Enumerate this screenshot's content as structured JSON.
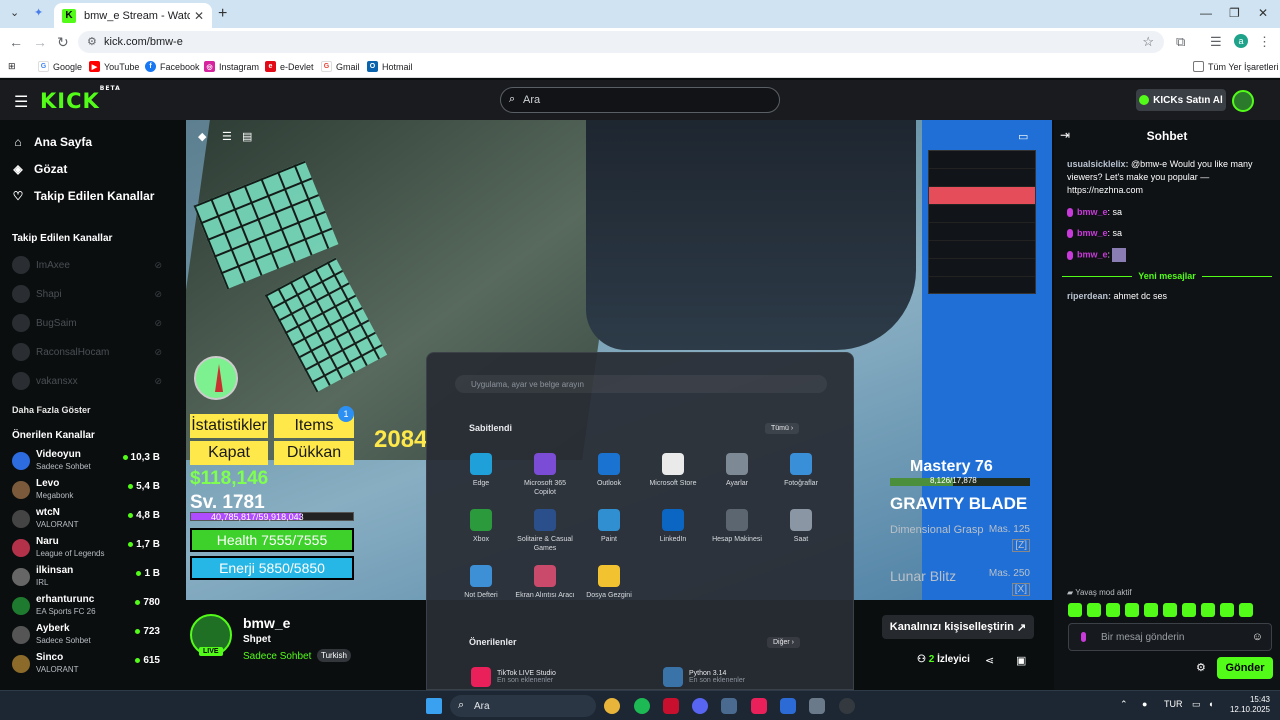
{
  "browser": {
    "tab_title": "bmw_e Stream - Watch Live on",
    "url": "kick.com/bmw-e",
    "bookmarks": [
      "Google",
      "YouTube",
      "Facebook",
      "Instagram",
      "e-Devlet",
      "Gmail",
      "Hotmail"
    ],
    "all_bookmarks": "Tüm Yer İşaretleri",
    "profile_initial": "a"
  },
  "header": {
    "logo": "KICK",
    "logo_beta": "BETA",
    "search_placeholder": "Ara",
    "kicks_button": "KICKs Satın Al"
  },
  "sidebar": {
    "nav": [
      {
        "label": "Ana Sayfa",
        "icon": "home-icon"
      },
      {
        "label": "Gözat",
        "icon": "compass-icon"
      },
      {
        "label": "Takip Edilen Kanallar",
        "icon": "heart-icon"
      }
    ],
    "followed_heading": "Takip Edilen Kanallar",
    "followed": [
      "ImAxee",
      "Shapi",
      "BugSaim",
      "RaconsalHocam",
      "vakansxx"
    ],
    "show_more": "Daha Fazla Göster",
    "recommended_heading": "Önerilen Kanallar",
    "recommended": [
      {
        "name": "Videoyun",
        "category": "Sadece Sohbet",
        "viewers": "10,3 B",
        "color": "#2d6cdf"
      },
      {
        "name": "Levo",
        "category": "Megabonk",
        "viewers": "5,4 B",
        "color": "#7a5a3a"
      },
      {
        "name": "wtcN",
        "category": "VALORANT",
        "viewers": "4,8 B",
        "color": "#444"
      },
      {
        "name": "Naru",
        "category": "League of Legends",
        "viewers": "1,7 B",
        "color": "#b3324a"
      },
      {
        "name": "ilkinsan",
        "category": "IRL",
        "viewers": "1 B",
        "color": "#666"
      },
      {
        "name": "erhanturunc",
        "category": "EA Sports FC 26",
        "viewers": "780",
        "color": "#1e7a2e"
      },
      {
        "name": "Ayberk",
        "category": "Sadece Sohbet",
        "viewers": "723",
        "color": "#555"
      },
      {
        "name": "Sinco",
        "category": "VALORANT",
        "viewers": "615",
        "color": "#8c6a2a"
      }
    ]
  },
  "game": {
    "btn_stats": "İstatistikler",
    "btn_items": "Items",
    "btn_close": "Kapat",
    "btn_shop": "Dükkan",
    "items_badge": "1",
    "score": "2084",
    "money": "$118,146",
    "level": "Sv. 1781",
    "xp": "40,785,817/59,918,043",
    "xp_fraction": 0.68,
    "health": "Health 7555/7555",
    "energy": "Enerji 5850/5850",
    "mastery": "Mastery 76",
    "mastery_xp": "8,126/17,878",
    "mastery_fraction": 0.45,
    "weapon": "GRAVITY BLADE",
    "skill1": "Dimensional Grasp",
    "skill1_mas": "Mas. 125",
    "skill1_key": "[Z]",
    "skill2": "Lunar Blitz",
    "skill2_mas": "Mas. 250",
    "skill2_key": "[X]"
  },
  "startmenu": {
    "search_placeholder": "Uygulama, ayar ve belge arayın",
    "pinned": "Sabitlendi",
    "all": "Tümü",
    "apps": [
      {
        "label": "Edge",
        "color": "#1fa0d8"
      },
      {
        "label": "Microsoft 365 Copilot",
        "color": "#7b4dd6"
      },
      {
        "label": "Outlook",
        "color": "#1a73d0"
      },
      {
        "label": "Microsoft Store",
        "color": "#eaeaea"
      },
      {
        "label": "Ayarlar",
        "color": "#7d8a96"
      },
      {
        "label": "Fotoğraflar",
        "color": "#3a8fd9"
      },
      {
        "label": "Xbox",
        "color": "#2b9a3c"
      },
      {
        "label": "Solitaire & Casual Games",
        "color": "#2a4f8a"
      },
      {
        "label": "Paint",
        "color": "#2f8fd0"
      },
      {
        "label": "LinkedIn",
        "color": "#0a66c2"
      },
      {
        "label": "Hesap Makinesi",
        "color": "#5c6670"
      },
      {
        "label": "Saat",
        "color": "#8a96a3"
      },
      {
        "label": "Not Defteri",
        "color": "#3d8fd6"
      },
      {
        "label": "Ekran Alıntısı Aracı",
        "color": "#c94a6a"
      },
      {
        "label": "Dosya Gezgini",
        "color": "#f2c230"
      }
    ],
    "recommended": "Önerilenler",
    "more": "Diğer",
    "rec_items": [
      {
        "title": "TikTok LIVE Studio",
        "sub": "En son eklenenler",
        "color": "#e9205a"
      },
      {
        "title": "Python 3.14",
        "sub": "En son eklenenler",
        "color": "#3a73a8"
      }
    ]
  },
  "stream": {
    "name": "bmw_e",
    "title": "Shpet",
    "category": "Sadece Sohbet",
    "language": "Turkish",
    "live": "LIVE",
    "customize": "Kanalınızı kişiselleştirin",
    "viewers_count": "2",
    "viewers_label": "İzleyici"
  },
  "chat": {
    "title": "Sohbet",
    "messages": [
      {
        "user": "usualsicklelix:",
        "text": " @bmw-e Would you like many viewers? Let's make you popular — https://nezhna.com"
      },
      {
        "user": "bmw_e",
        "text": ": sa"
      },
      {
        "user": "bmw_e",
        "text": ": sa"
      },
      {
        "user": "bmw_e",
        "text": ":"
      }
    ],
    "new_messages": "Yeni mesajlar",
    "after": {
      "user": "riperdean:",
      "text": " ahmet dc ses"
    },
    "slow_mode": "Yavaş mod aktif",
    "input_placeholder": "Bir mesaj gönderin",
    "send": "Gönder"
  },
  "taskbar": {
    "search": "Ara",
    "lang": "TUR",
    "time": "15:43",
    "date": "12.10.2025"
  }
}
